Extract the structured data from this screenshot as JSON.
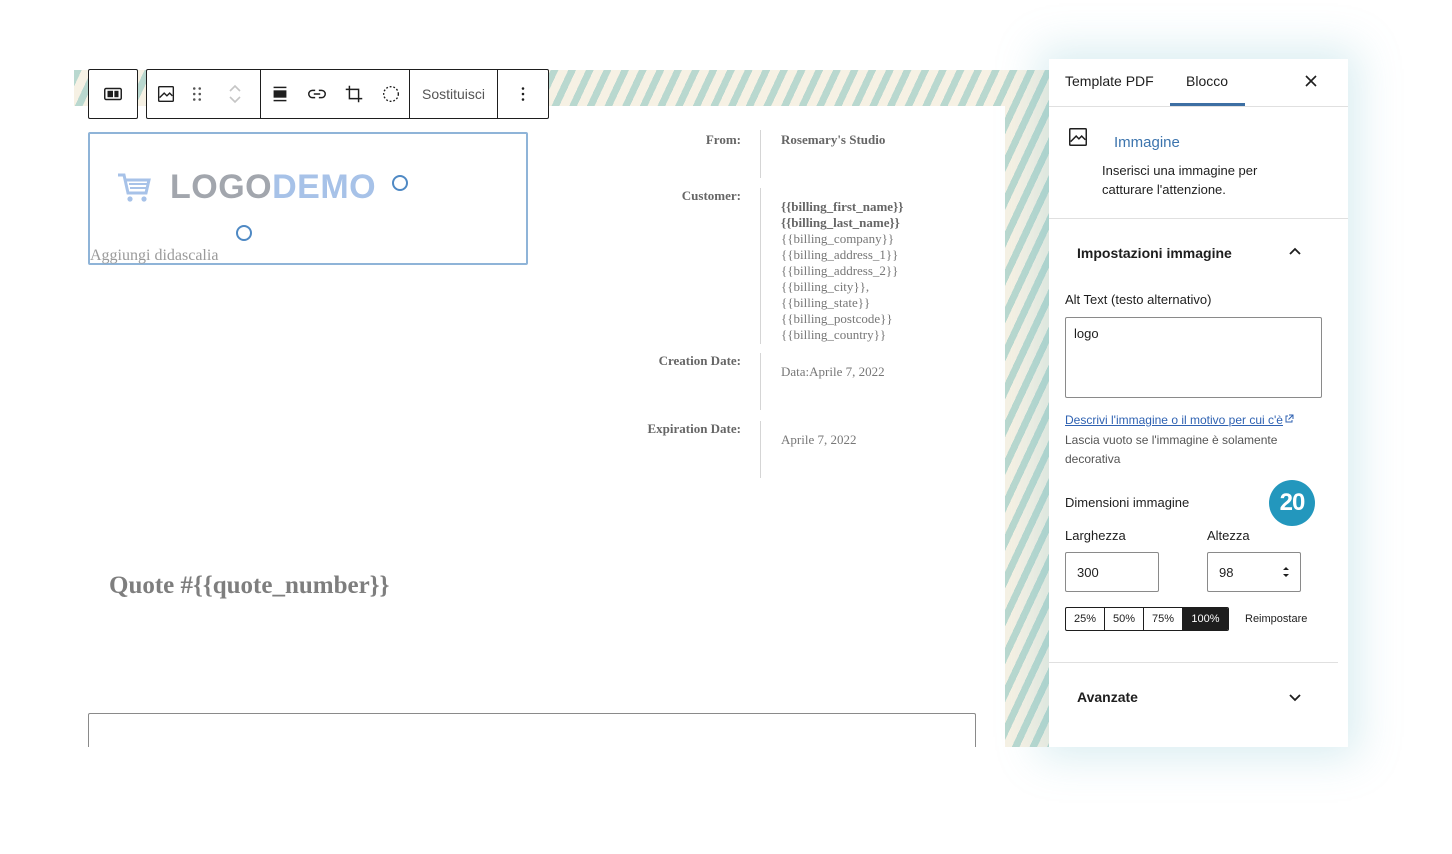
{
  "toolbar": {
    "replace_label": "Sostituisci",
    "icons": [
      "block-switcher-icon",
      "image-icon",
      "drag-handle-icon",
      "move-up-icon",
      "move-down-icon",
      "align-icon",
      "link-icon",
      "crop-icon",
      "duotone-icon",
      "more-options-icon"
    ]
  },
  "logo_block": {
    "logo_text_left": "LOGO",
    "logo_text_right": "DEMO",
    "caption_placeholder": "Aggiungi didascalia"
  },
  "document": {
    "from_label": "From:",
    "from_value": "Rosemary's Studio",
    "customer_label": "Customer:",
    "customer_lines": [
      "{{billing_first_name}}",
      "{{billing_last_name}}",
      "{{billing_company}}",
      "{{billing_address_1}}",
      "{{billing_address_2}}",
      "{{billing_city}},",
      "{{billing_state}}",
      "{{billing_postcode}}",
      "{{billing_country}}"
    ],
    "creation_label": "Creation Date:",
    "creation_value": "Data:Aprile 7, 2022",
    "expiration_label": "Expiration Date:",
    "expiration_value": "Aprile 7, 2022",
    "quote_title": "Quote #{{quote_number}}"
  },
  "sidebar": {
    "tabs": [
      "Template PDF",
      "Blocco"
    ],
    "active_tab": "Blocco",
    "block_title": "Immagine",
    "block_description": "Inserisci una immagine per catturare l'attenzione.",
    "settings_panel_title": "Impostazioni immagine",
    "alt_text_label": "Alt Text (testo alternativo)",
    "alt_text_value": "logo",
    "help_link": "Descrivi l'immagine o il motivo per cui c'è",
    "help_text": "Lascia vuoto se l'immagine è solamente decorativa",
    "dimensions_label": "Dimensioni immagine",
    "badge": "20",
    "width_label": "Larghezza",
    "width_value": "300",
    "height_label": "Altezza",
    "height_value": "98",
    "percent_options": [
      "25%",
      "50%",
      "75%",
      "100%"
    ],
    "active_percent": "100%",
    "reset_label": "Reimpostare",
    "advanced_panel_title": "Avanzate"
  },
  "colors": {
    "accent": "#3c74ad",
    "badge": "#2397bd",
    "selection": "#8fb4d8"
  }
}
